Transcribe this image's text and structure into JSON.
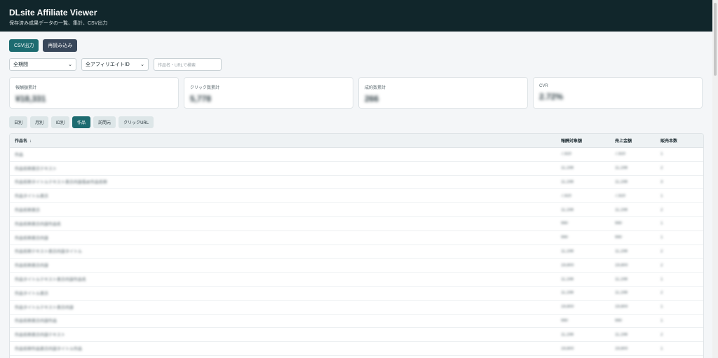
{
  "header": {
    "title": "DLsite Affiliate Viewer",
    "subtitle": "保存済み成果データの一覧、集計、CSV出力"
  },
  "toolbar": {
    "csv_label": "CSV出力",
    "reload_label": "再読み込み"
  },
  "filters": {
    "period": "全期間",
    "affiliate_id": "全アフィリエイトID",
    "search_placeholder": "作品名・URLで検索"
  },
  "cards": [
    {
      "label": "報酬額累計",
      "value": "¥18,331"
    },
    {
      "label": "クリック数累計",
      "value": "5,778"
    },
    {
      "label": "成約数累計",
      "value": "266"
    },
    {
      "label": "CVR",
      "value": "2.72%"
    }
  ],
  "tabs": [
    {
      "label": "日別",
      "active": false
    },
    {
      "label": "月別",
      "active": false
    },
    {
      "label": "ID別",
      "active": false
    },
    {
      "label": "作品",
      "active": true
    },
    {
      "label": "訪問元",
      "active": false
    },
    {
      "label": "クリックURL",
      "active": false
    }
  ],
  "table": {
    "headers": {
      "name": "作品名",
      "reward": "報酬対象額",
      "sales": "売上金額",
      "count": "販売本数"
    },
    "rows": [
      {
        "name": "作品",
        "reward": "7,920",
        "sales": "7,920",
        "count": "1"
      },
      {
        "name": "作品名称表示テキスト",
        "reward": "11,198",
        "sales": "11,198",
        "count": "2"
      },
      {
        "name": "作品名称タイトルテキスト表示内容長め作品名称",
        "reward": "11,198",
        "sales": "11,198",
        "count": "3"
      },
      {
        "name": "作品タイトル表示",
        "reward": "7,920",
        "sales": "7,920",
        "count": "1"
      },
      {
        "name": "作品名称表示",
        "reward": "11,198",
        "sales": "11,198",
        "count": "2"
      },
      {
        "name": "作品名称表示内容作品名",
        "reward": "990",
        "sales": "990",
        "count": "1"
      },
      {
        "name": "作品名称表示内容",
        "reward": "990",
        "sales": "990",
        "count": "1"
      },
      {
        "name": "作品名称テキスト表示内容タイトル",
        "reward": "11,198",
        "sales": "11,198",
        "count": "2"
      },
      {
        "name": "作品名称表示内容",
        "reward": "19,800",
        "sales": "19,800",
        "count": "2"
      },
      {
        "name": "作品タイトルテキスト表示内容作品名",
        "reward": "11,198",
        "sales": "11,198",
        "count": "1"
      },
      {
        "name": "作品タイトル表示",
        "reward": "11,198",
        "sales": "11,198",
        "count": "2"
      },
      {
        "name": "作品タイトルテキスト表示内容",
        "reward": "19,800",
        "sales": "19,800",
        "count": "1"
      },
      {
        "name": "作品名称表示内容作品",
        "reward": "990",
        "sales": "990",
        "count": "1"
      },
      {
        "name": "作品名称表示内容テキスト",
        "reward": "11,198",
        "sales": "11,198",
        "count": "2"
      },
      {
        "name": "作品名称作品表示内容タイトル作品",
        "reward": "19,800",
        "sales": "19,800",
        "count": "1"
      },
      {
        "name": "作品名称表示",
        "reward": "7,920",
        "sales": "7,920",
        "count": "1"
      }
    ]
  }
}
